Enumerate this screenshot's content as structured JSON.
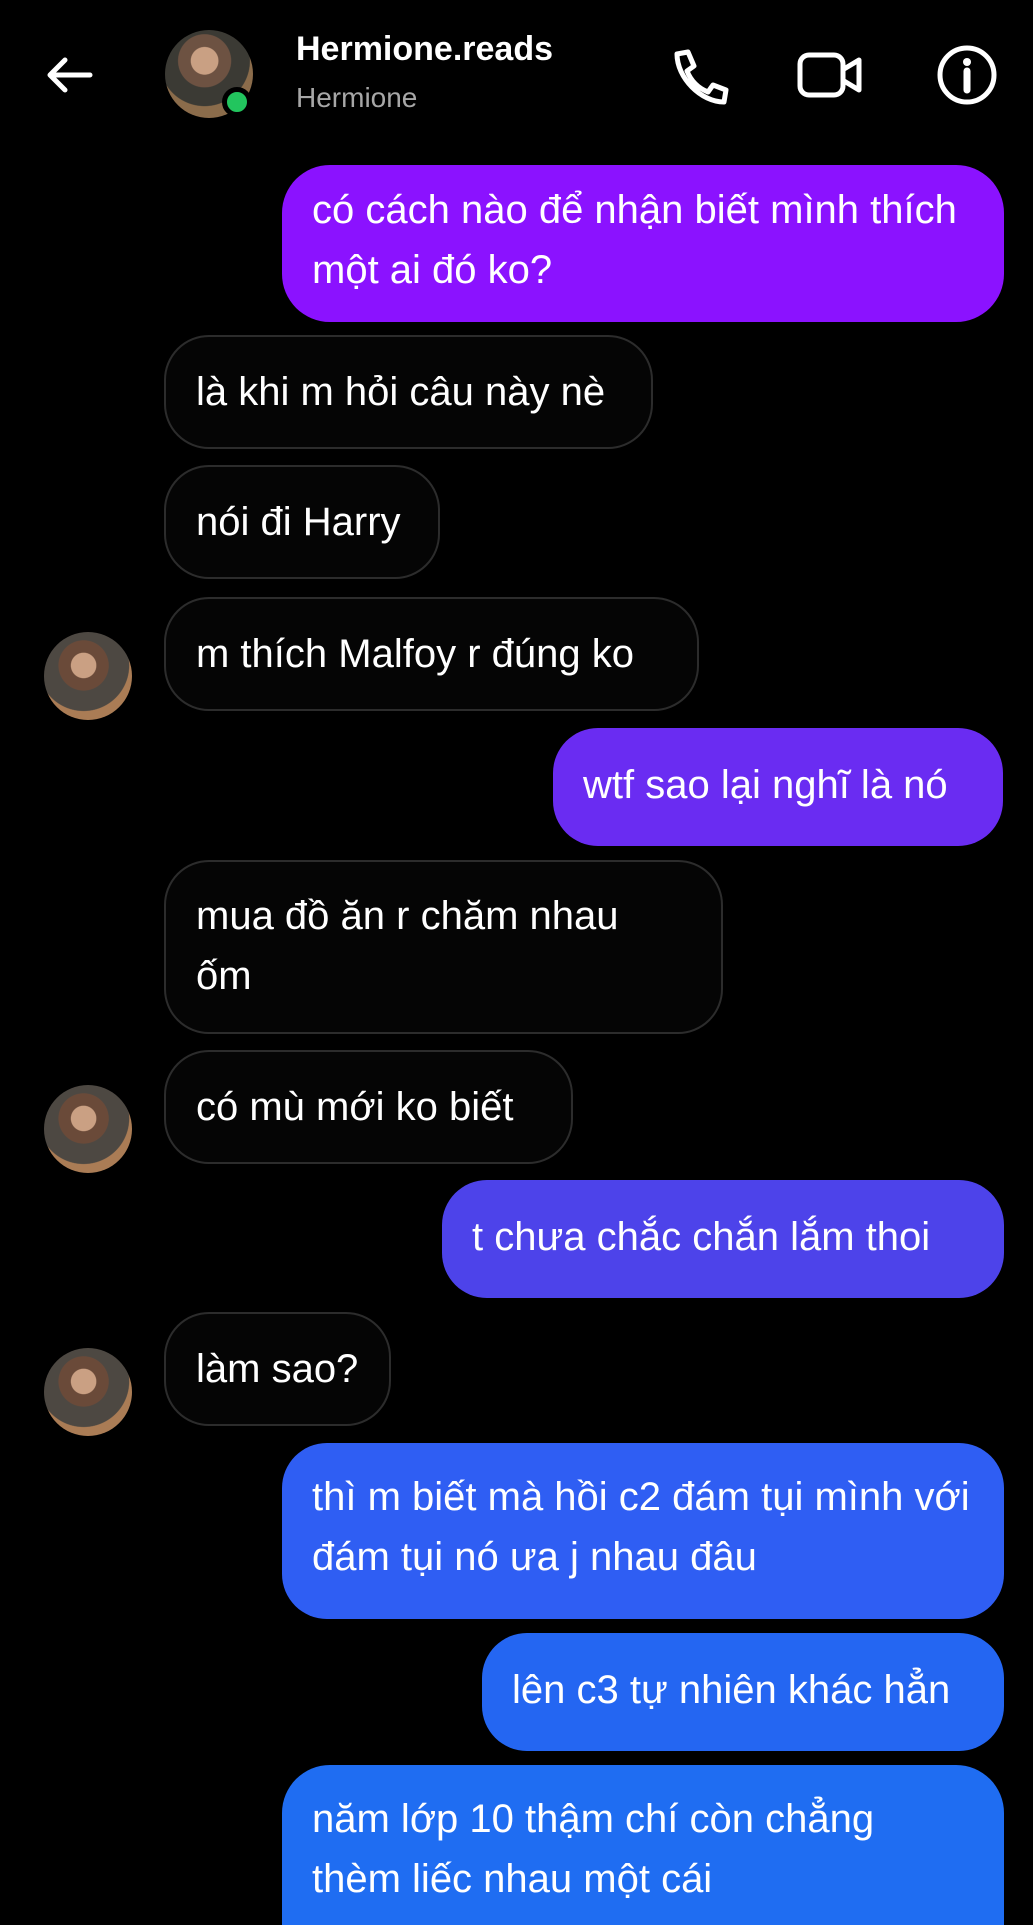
{
  "header": {
    "name": "Hermione.reads",
    "subtitle": "Hermione",
    "online_color": "#22c55e",
    "icons": [
      "back-arrow-icon",
      "phone-icon",
      "video-camera-icon",
      "info-icon"
    ]
  },
  "messages": [
    {
      "from": "me",
      "text": "có cách nào để nhận biết mình thích một ai đó ko?",
      "color": "#8b12ff"
    },
    {
      "from": "them",
      "text": "là khi m hỏi câu này nè"
    },
    {
      "from": "them",
      "text": "nói đi Harry"
    },
    {
      "from": "them",
      "text": "m thích Malfoy r đúng ko"
    },
    {
      "from": "me",
      "text": "wtf sao lại nghĩ là nó",
      "color": "#6a2cf2"
    },
    {
      "from": "them",
      "text": "mua đồ ăn r chăm nhau ốm"
    },
    {
      "from": "them",
      "text": "có mù mới ko biết"
    },
    {
      "from": "me",
      "text": "t chưa chắc chắn lắm thoi",
      "color": "#4d43ea"
    },
    {
      "from": "them",
      "text": "làm sao?"
    },
    {
      "from": "me",
      "text": "thì m biết mà hồi c2 đám tụi mình với đám tụi nó ưa j nhau đâu",
      "color": "#2f5ef3"
    },
    {
      "from": "me",
      "text": "lên c3 tự nhiên khác hẳn",
      "color": "#2466f2"
    },
    {
      "from": "me",
      "text": "năm lớp 10 thậm chí còn chẳng thèm liếc nhau một cái",
      "color": "#1f6df2"
    }
  ]
}
